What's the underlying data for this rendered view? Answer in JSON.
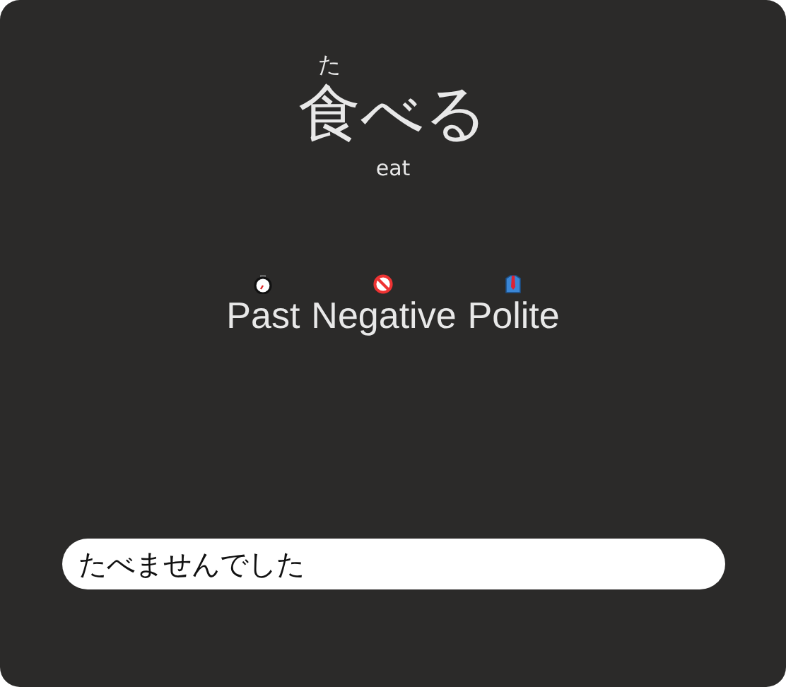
{
  "word": {
    "kanji": "食",
    "reading": "た",
    "kana": "べる"
  },
  "meaning": "eat",
  "form": [
    {
      "kind": "time",
      "label": "Past"
    },
    {
      "kind": "negative",
      "label": "Negative"
    },
    {
      "kind": "polite",
      "label": "Polite"
    }
  ],
  "answer": {
    "value": "たべませんでした"
  }
}
